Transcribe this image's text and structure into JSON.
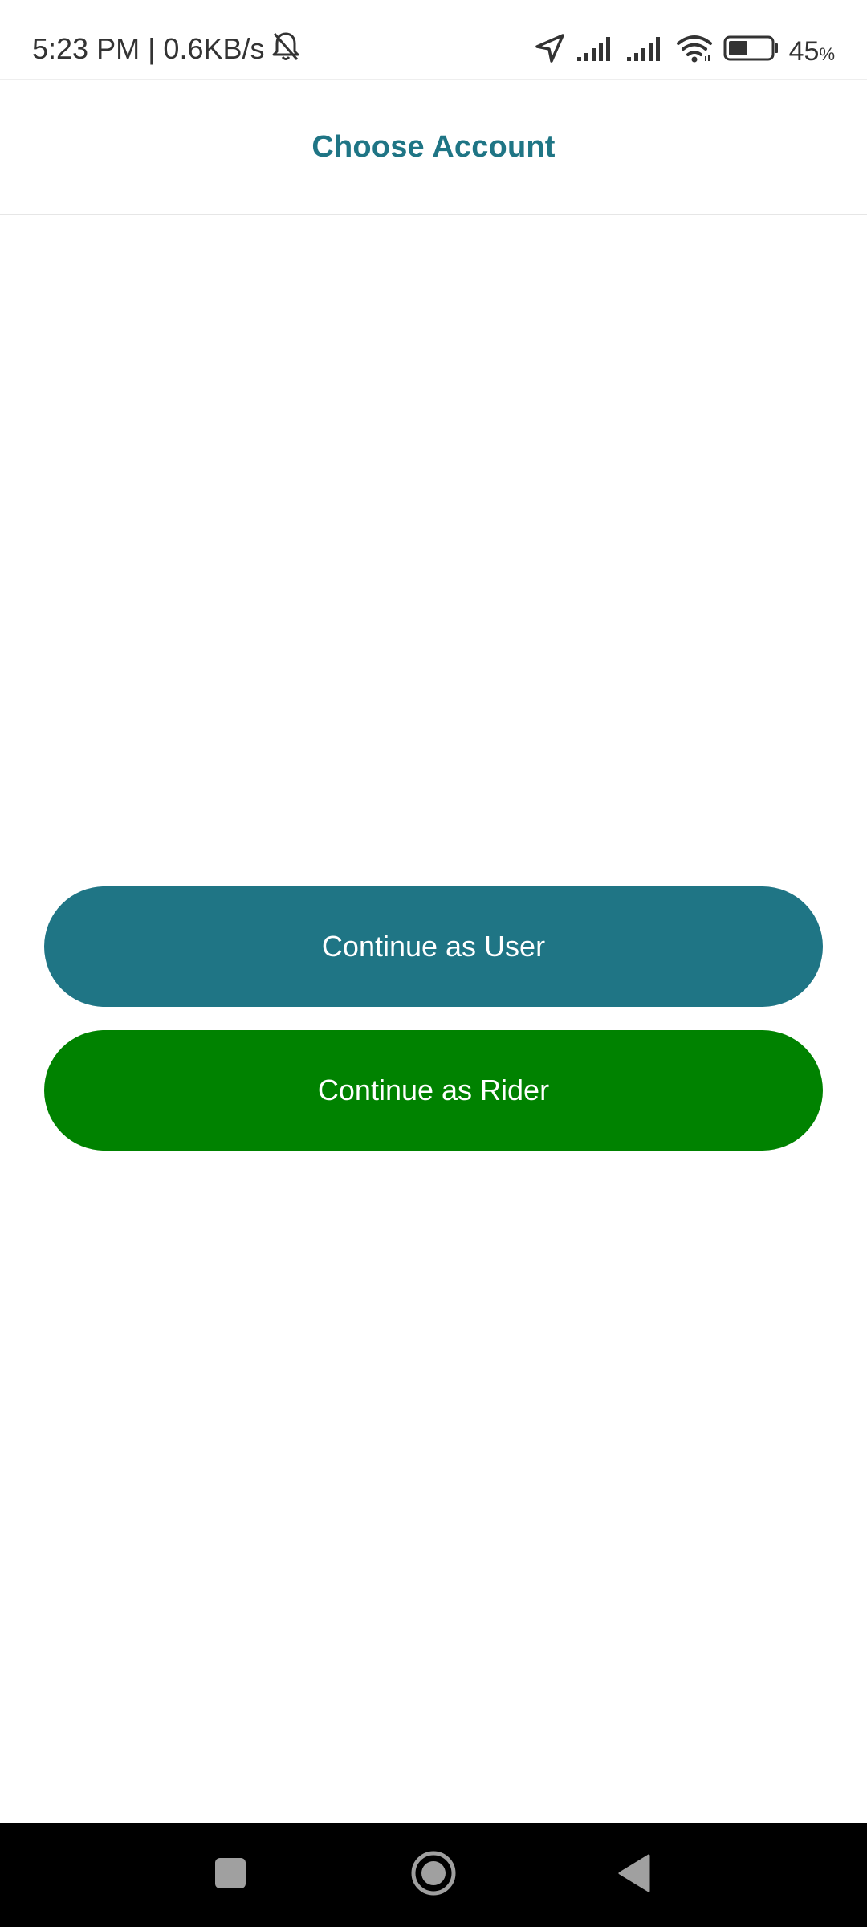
{
  "status_bar": {
    "time_speed": "5:23 PM | 0.6KB/s",
    "battery_value": "45",
    "battery_unit": "%",
    "battery_level_percent": 45,
    "icons": [
      "bell-off-icon",
      "location-arrow-icon",
      "signal-icon",
      "signal-icon",
      "wifi-icon",
      "battery-icon"
    ]
  },
  "header": {
    "title": "Choose Account"
  },
  "buttons": {
    "user_label": "Continue as User",
    "rider_label": "Continue as Rider"
  },
  "nav_bar": {
    "icons": [
      "recent-apps-icon",
      "home-icon",
      "back-icon"
    ]
  },
  "colors": {
    "primary": "#1F7585",
    "rider_green": "#008200",
    "nav_background": "#000000",
    "nav_icons": "#a0a0a0"
  }
}
